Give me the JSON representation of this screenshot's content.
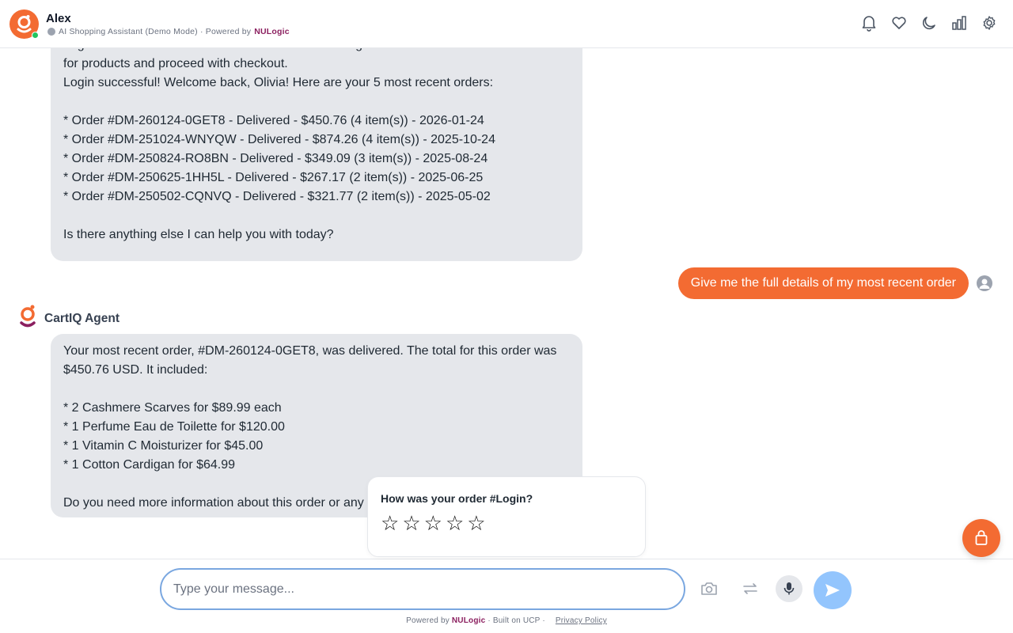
{
  "header": {
    "title": "Alex",
    "subtitle_prefix": "AI Shopping Assistant (Demo Mode) · Powered by",
    "brand": "NULogic",
    "icons": [
      "bell-icon",
      "heart-icon",
      "moon-icon",
      "chart-bars-icon",
      "gear-icon"
    ]
  },
  "messages": {
    "agent_1": "Login successful! You are now authenticated as a registered user. You can now search\nfor products and proceed with checkout.\nLogin successful! Welcome back, Olivia! Here are your 5 most recent orders:\n\n* Order #DM-260124-0GET8 - Delivered - $450.76 (4 item(s)) - 2026-01-24\n* Order #DM-251024-WNYQW - Delivered - $874.26 (4 item(s)) - 2025-10-24\n* Order #DM-250824-RO8BN - Delivered - $349.09 (3 item(s)) - 2025-08-24\n* Order #DM-250625-1HH5L - Delivered - $267.17 (2 item(s)) - 2025-06-25\n* Order #DM-250502-CQNVQ - Delivered - $321.77 (2 item(s)) - 2025-05-02\n\nIs there anything else I can help you with today?",
    "user_1": "Give me the full details of my most recent order",
    "agent_name": "CartIQ Agent",
    "agent_2": "Your most recent order, #DM-260124-0GET8, was delivered. The total for this order was\n$450.76 USD. It included:\n\n* 2 Cashmere Scarves for $89.99 each\n* 1 Perfume Eau de Toilette for $120.00\n* 1 Vitamin C Moisturizer for $45.00\n* 1 Cotton Cardigan for $64.99\n\nDo you need more information about this order or any"
  },
  "rating": {
    "title": "How was your order #Login?",
    "stars": 5,
    "selected": 0,
    "star_glyph": "☆"
  },
  "composer": {
    "placeholder": "Type your message...",
    "value": "",
    "icons": [
      "camera-icon",
      "swap-arrows-icon",
      "microphone-icon",
      "send-icon"
    ]
  },
  "footer": {
    "powered_prefix": "Powered by",
    "brand": "NULogic",
    "built": "· Built on UCP ·",
    "privacy": "Privacy Policy"
  },
  "colors": {
    "accent": "#f36b32",
    "brand": "#8b1f5f",
    "agent_bubble": "#e5e7eb",
    "send_button": "#93c5fd",
    "input_border": "#7aa7e0"
  },
  "fab": {
    "icon": "shopping-bag-icon"
  }
}
